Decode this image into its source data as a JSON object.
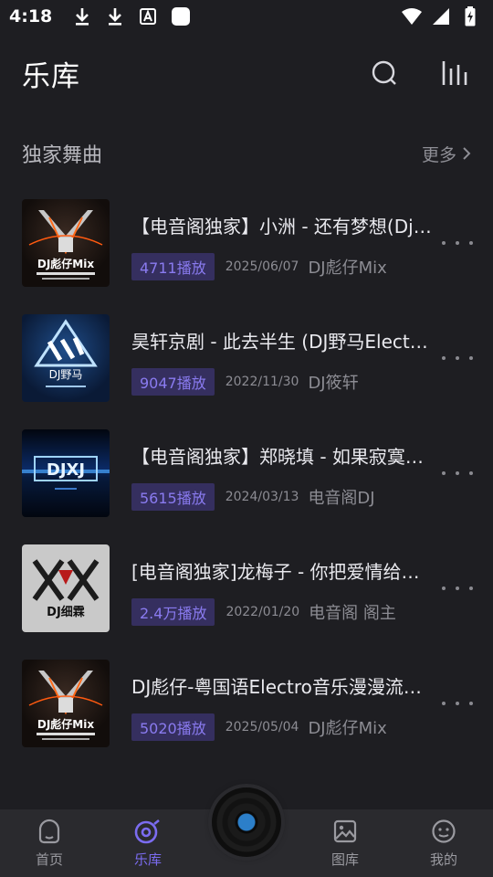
{
  "status_bar": {
    "time": "4:18"
  },
  "header": {
    "title": "乐库"
  },
  "section": {
    "title": "独家舞曲",
    "more_label": "更多"
  },
  "tracks": [
    {
      "title": "【电音阁独家】小洲 - 还有梦想(Dj…",
      "plays": "4711播放",
      "date": "2025/06/07",
      "artist": "DJ彪仔Mix",
      "cover_text": "DJ彪仔Mix"
    },
    {
      "title": "昊轩京剧 - 此去半生 (DJ野马Elect…",
      "plays": "9047播放",
      "date": "2022/11/30",
      "artist": "DJ筱轩",
      "cover_text": "DJ野马"
    },
    {
      "title": "【电音阁独家】郑晓填 - 如果寂寞…",
      "plays": "5615播放",
      "date": "2024/03/13",
      "artist": "电音阁DJ",
      "cover_text": "DJXJ"
    },
    {
      "title": "[电音阁独家]龙梅子 - 你把爱情给…",
      "plays": "2.4万播放",
      "date": "2022/01/20",
      "artist": "电音阁 阁主",
      "cover_text": "DJ细霖"
    },
    {
      "title": "DJ彪仔-粤国语Electro音乐漫漫流…",
      "plays": "5020播放",
      "date": "2025/05/04",
      "artist": "DJ彪仔Mix",
      "cover_text": "DJ彪仔Mix"
    }
  ],
  "bottom_nav": {
    "home": "首页",
    "library": "乐库",
    "gallery": "图库",
    "mine": "我的"
  },
  "colors": {
    "accent": "#7b6cf0",
    "background": "#1e1e22",
    "nav_background": "#2a2a2e"
  },
  "icons": {
    "search": "search-icon",
    "equalizer": "equalizer-icon",
    "more": "more-dots-icon",
    "chevron": "chevron-right-icon"
  }
}
